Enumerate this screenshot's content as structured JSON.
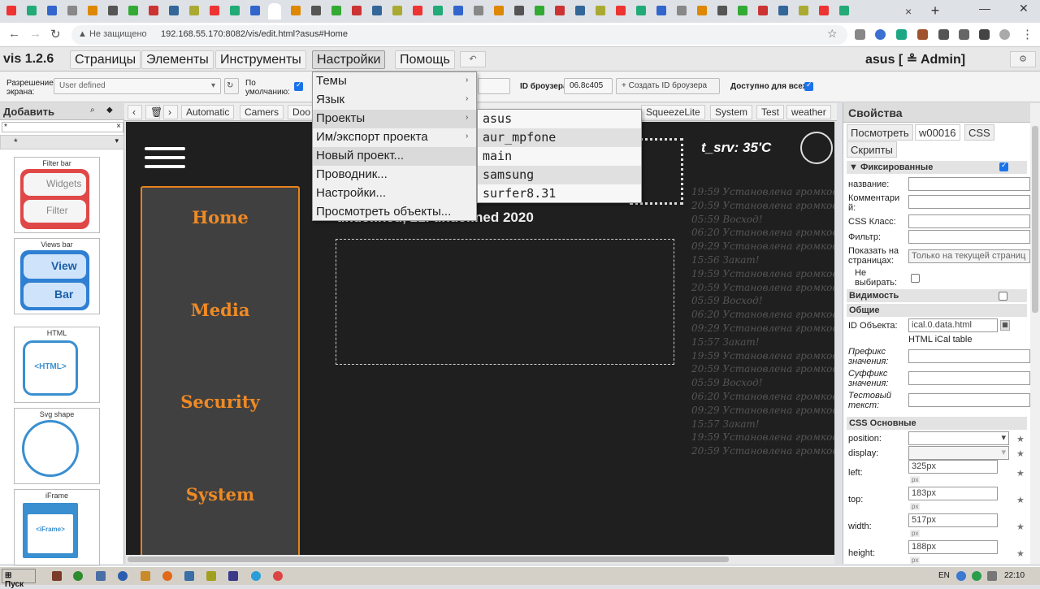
{
  "browser": {
    "close_tab": "×",
    "new_tab": "+",
    "win_min": "—",
    "win_close": "✕",
    "security": "Не защищено",
    "url": "192.168.55.170:8082/vis/edit.html?asus#Home"
  },
  "app": {
    "version": "vis 1.2.6",
    "user": "asus [ ≗ Admin]",
    "menu": [
      "Страницы",
      "Элементы",
      "Инструменты",
      "Настройки",
      "Помощь"
    ],
    "undo": "↶"
  },
  "toolbar": {
    "resolution_label": "Разрешение экрана:",
    "resolution_value": "User defined",
    "default_label": "По умолчанию:",
    "browser_id_label": "ID броузера",
    "browser_id_value": "06.8c405",
    "create_id_button": "+ Создать ID броузера",
    "available_all_label": "Доступно для всех:"
  },
  "left_panel": {
    "title": "Добавить",
    "filter_value": "*",
    "filter_clear": "×",
    "group_value": "*",
    "widgets": [
      {
        "title": "Filter bar",
        "lines": [
          "Widgets",
          "Filter"
        ]
      },
      {
        "title": "Views bar",
        "lines": [
          "View",
          "Bar"
        ]
      },
      {
        "title": "HTML",
        "lines": [
          "<HTML>"
        ]
      },
      {
        "title": "Svg shape",
        "lines": []
      },
      {
        "title": "iFrame",
        "lines": [
          "<iFrame>"
        ]
      }
    ]
  },
  "view_tabs": [
    "Automatic",
    "Camers",
    "Doo",
    "SqueezeLite",
    "System",
    "Test",
    "weather"
  ],
  "canvas": {
    "nav": [
      "Home",
      "Media",
      "Security",
      "System"
    ],
    "date": "undefined, 21. undefined 2020",
    "temperature": "t_srv: 35'C",
    "log": [
      "19:59 Установлена громкость",
      "20:59 Установлена громкость",
      "05:59 Восход!",
      "06:20 Установлена громкость",
      "09:29 Установлена громкость",
      "15:56 Закат!",
      "19:59 Установлена громкость",
      "20:59 Установлена громкость",
      "05:59 Восход!",
      "06:20 Установлена громкость",
      "09:29 Установлена громкость",
      "15:57 Закат!",
      "19:59 Установлена громкость",
      "20:59 Установлена громкость",
      "05:59 Восход!",
      "06:20 Установлена громкость",
      "09:29 Установлена громкость",
      "15:57 Закат!",
      "19:59 Установлена громкость",
      "20:59 Установлена громкость"
    ]
  },
  "settings_menu": {
    "items": [
      "Темы",
      "Язык",
      "Проекты",
      "Им/экспорт проекта",
      "Новый проект...",
      "Проводник...",
      "Настройки...",
      "Просмотреть объекты..."
    ],
    "submenu_arrow": "›"
  },
  "projects_menu": {
    "items": [
      "asus",
      "aur_mpfone",
      "main",
      "samsung",
      "surfer8.31"
    ]
  },
  "properties": {
    "title": "Свойства",
    "tabs": [
      "Посмотреть",
      "w00016",
      "CSS",
      "Скрипты"
    ],
    "fixed_section": "Фиксированные",
    "fields": {
      "name_label": "название:",
      "comment_label": "Комментари й:",
      "css_class_label": "CSS Класс:",
      "filter_label": "Фильтр:",
      "show_on_label": "Показать на страницах:",
      "show_on_value": "Только на текущей страниц",
      "no_select_label": "Не выбирать:"
    },
    "visibility_section": "Видимость",
    "general_section": "Общие",
    "general": {
      "object_id_label": "ID Объекта:",
      "object_id_value": "ical.0.data.html",
      "object_hint": "HTML iCal table",
      "prefix_label": "Префикс значения:",
      "suffix_label": "Суффикс значения:",
      "test_label": "Тестовый текст:"
    },
    "css_section": "CSS Основные",
    "css": {
      "position_label": "position:",
      "display_label": "display:",
      "left_label": "left:",
      "left_value": "325px",
      "top_label": "top:",
      "top_value": "183px",
      "width_label": "width:",
      "width_value": "517px",
      "height_label": "height:",
      "height_value": "188px",
      "unit": "px"
    }
  },
  "taskbar": {
    "start": "Пуск",
    "lang": "EN",
    "time": "22:10"
  }
}
